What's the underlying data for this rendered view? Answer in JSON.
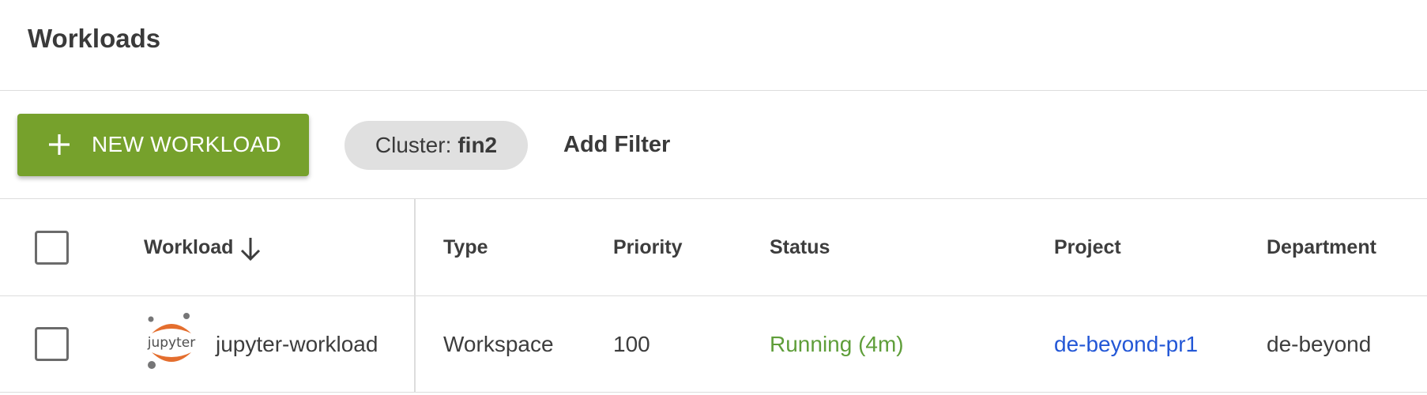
{
  "page": {
    "title": "Workloads"
  },
  "toolbar": {
    "new_button_label": "NEW WORKLOAD",
    "filter_chip": {
      "key": "Cluster:",
      "value": "fin2"
    },
    "add_filter_label": "Add Filter"
  },
  "table": {
    "columns": [
      "Workload",
      "Type",
      "Priority",
      "Status",
      "Project",
      "Department"
    ],
    "sort": {
      "column": "Workload",
      "direction": "descending"
    },
    "rows": [
      {
        "icon": "jupyter-logo-icon",
        "icon_text": "jupyter",
        "workload": "jupyter-workload",
        "type": "Workspace",
        "priority": "100",
        "status": "Running (4m)",
        "project": "de-beyond-pr1",
        "department": "de-beyond"
      }
    ]
  },
  "colors": {
    "accent_green": "#76a12c",
    "status_running": "#5f9e3a",
    "link_blue": "#2357d6",
    "chip_bg": "#e0e0e0",
    "jupyter_orange": "#e46e2e"
  }
}
